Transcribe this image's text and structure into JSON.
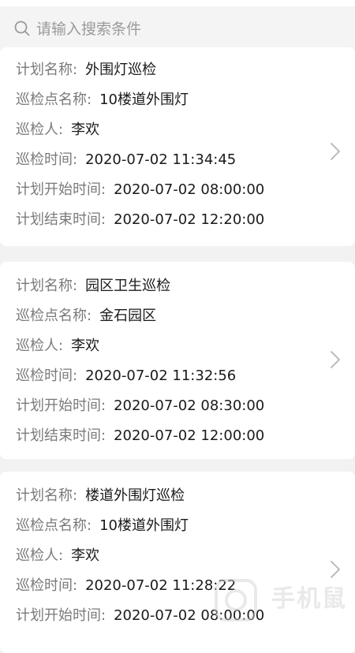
{
  "search": {
    "placeholder": "请输入搜索条件"
  },
  "labels": {
    "plan_name": "计划名称:",
    "checkpoint_name": "巡检点名称:",
    "inspector": "巡检人:",
    "inspect_time": "巡检时间:",
    "plan_start": "计划开始时间:",
    "plan_end": "计划结束时间:"
  },
  "records": [
    {
      "plan_name": "外围灯巡检",
      "checkpoint_name": "10楼道外围灯",
      "inspector": "李欢",
      "inspect_time": "2020-07-02 11:34:45",
      "plan_start": "2020-07-02 08:00:00",
      "plan_end": "2020-07-02 12:20:00"
    },
    {
      "plan_name": "园区卫生巡检",
      "checkpoint_name": "金石园区",
      "inspector": "李欢",
      "inspect_time": "2020-07-02 11:32:56",
      "plan_start": "2020-07-02 08:30:00",
      "plan_end": "2020-07-02 12:00:00"
    },
    {
      "plan_name": "楼道外围灯巡检",
      "checkpoint_name": "10楼道外围灯",
      "inspector": "李欢",
      "inspect_time": "2020-07-02 11:28:22",
      "plan_start": "2020-07-02 08:00:00"
    }
  ],
  "watermark": {
    "text": "手机鼠"
  },
  "icons": {
    "search": "search-icon",
    "chevron": "chevron-right-icon"
  },
  "colors": {
    "background": "#f2f2f2",
    "card": "#ffffff",
    "label": "#7a7a7a",
    "value": "#1a1a1a"
  }
}
